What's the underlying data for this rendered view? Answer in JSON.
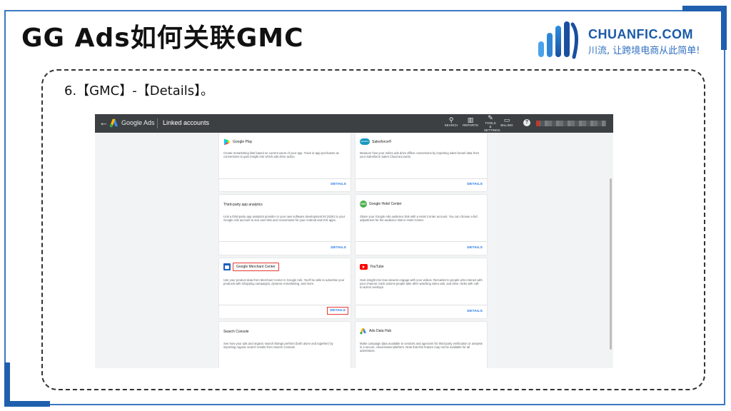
{
  "slide": {
    "title": "GG Ads如何关联GMC",
    "step": "6.【GMC】-【Details】。"
  },
  "logo": {
    "brand": "CHUANFIC.COM",
    "slogan": "川流, 让跨境电商从此简单!"
  },
  "colors": {
    "frame_blue": "#1f5fae",
    "brand_blue": "#1b5aa9",
    "topbar": "#3c4043",
    "link_blue": "#1a73e8",
    "highlight_red": "#e53935"
  },
  "screenshot": {
    "topbar": {
      "back_icon": "arrow-left-icon",
      "app_name": "Google Ads",
      "page_title": "Linked accounts",
      "tools": [
        {
          "icon": "search-icon",
          "label": "SEARCH"
        },
        {
          "icon": "reports-icon",
          "label": "REPORTS"
        },
        {
          "icon": "wrench-icon",
          "label": "TOOLS & SETTINGS"
        },
        {
          "icon": "billing-icon",
          "label": "BILLING"
        }
      ],
      "help_icon": "?"
    },
    "cards": [
      {
        "name": "Google Play",
        "icon": "google-play-icon",
        "description": "Create remarketing lists based on current users of your app. Track in-app purchases as conversions to gain insight into which ads drive action.",
        "details": "DETAILS"
      },
      {
        "name": "Salesforce®",
        "icon": "salesforce-icon",
        "icon_text": "salesforce",
        "description": "Measure how your online ads drive offline conversions by importing sales funnel data from your Salesforce Sales Cloud accounts.",
        "details": "DETAILS"
      },
      {
        "name": "Third-party app analytics",
        "description": "Link a third-party app analytics provider or your own software development kit (SDK) to your Google Ads account to see user lists and conversions for your Android and iOS apps.",
        "details": "DETAILS"
      },
      {
        "name": "Google Hotel Center",
        "icon": "hotel-center-icon",
        "icon_text": "GHC",
        "description": "Share your Google Ads audience lists with a Hotel Center account. You can choose a bid adjustment for the audience lists in Hotel Center.",
        "details": "DETAILS"
      },
      {
        "name": "Google Merchant Center",
        "icon": "merchant-center-icon",
        "description": "Use your product data from Merchant Center in Google Ads. You'll be able to advertise your products with Shopping campaigns, dynamic remarketing, and more.",
        "details": "DETAILS",
        "highlighted": true
      },
      {
        "name": "YouTube",
        "icon": "youtube-icon",
        "description": "Gain insight into how viewers engage with your videos. Remarket to people who interact with your channel, track actions people take after watching video ads, and drive clicks with call-to-action overlays.",
        "details": "DETAILS"
      },
      {
        "name": "Search Console",
        "description": "See how your ads and organic search listings perform (both alone and together) by importing organic search results from Search Console."
      },
      {
        "name": "Ads Data Hub",
        "icon": "ads-data-hub-icon",
        "description": "Make campaign data available to vendors and agencies for third-party verification or analysis in a secure, cloud-based platform. Note that this feature may not be available for all advertisers."
      }
    ]
  }
}
